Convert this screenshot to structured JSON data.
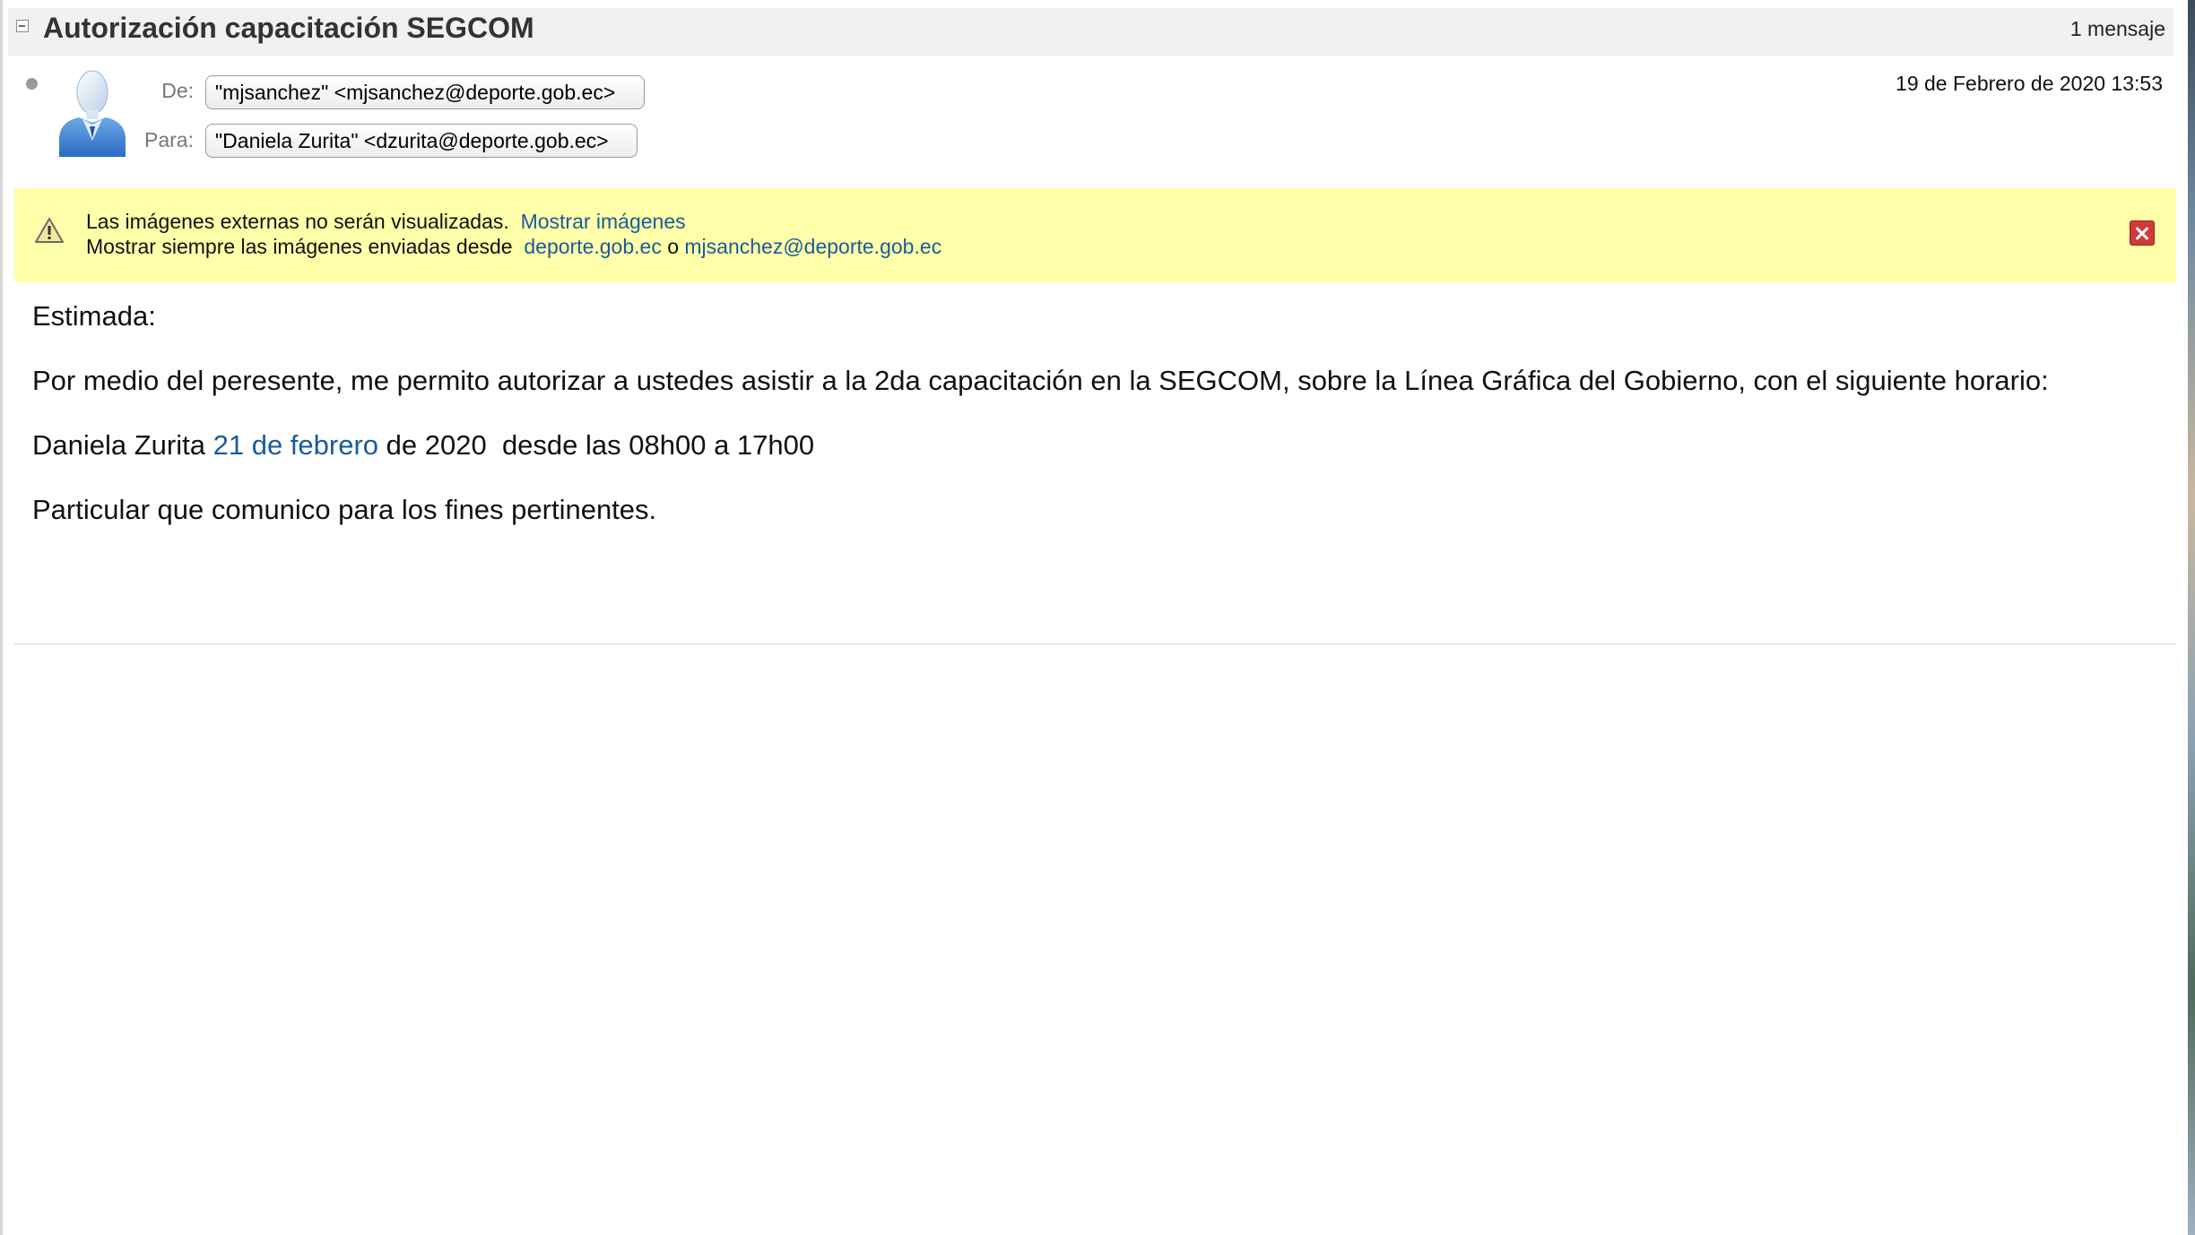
{
  "conversation": {
    "subject": "Autorización capacitación SEGCOM",
    "message_count": "1 mensaje"
  },
  "message": {
    "from_label": "De:",
    "from": "\"mjsanchez\" <mjsanchez@deporte.gob.ec>",
    "to_label": "Para:",
    "to": "\"Daniela Zurita\" <dzurita@deporte.gob.ec>",
    "date": "19 de Febrero de 2020 13:53"
  },
  "image_warning": {
    "line1_text": "Las imágenes externas no serán visualizadas.",
    "show_images_link": "Mostrar imágenes",
    "line2_text": "Mostrar siempre las imágenes enviadas desde",
    "domain_link": "deporte.gob.ec",
    "or_text": "o",
    "sender_link": "mjsanchez@deporte.gob.ec"
  },
  "body": {
    "greeting": "Estimada:",
    "paragraph1": "Por medio del peresente, me permito autorizar a ustedes asistir a la 2da capacitación en la SEGCOM, sobre la Línea Gráfica del Gobierno, con el siguiente horario:",
    "schedule_name": "Daniela Zurita",
    "schedule_date_link": "21 de febrero",
    "schedule_rest": "de 2020  desde las 08h00 a 17h00",
    "closing": "Particular que comunico para los fines pertinentes."
  },
  "icons": {
    "collapse": "collapse-minus-icon",
    "avatar": "user-avatar-icon",
    "warning": "warning-triangle-icon",
    "close": "close-icon"
  },
  "colors": {
    "link": "#1a5b9b",
    "warning_bg": "#ffffaa",
    "close_red": "#d13a3a"
  }
}
